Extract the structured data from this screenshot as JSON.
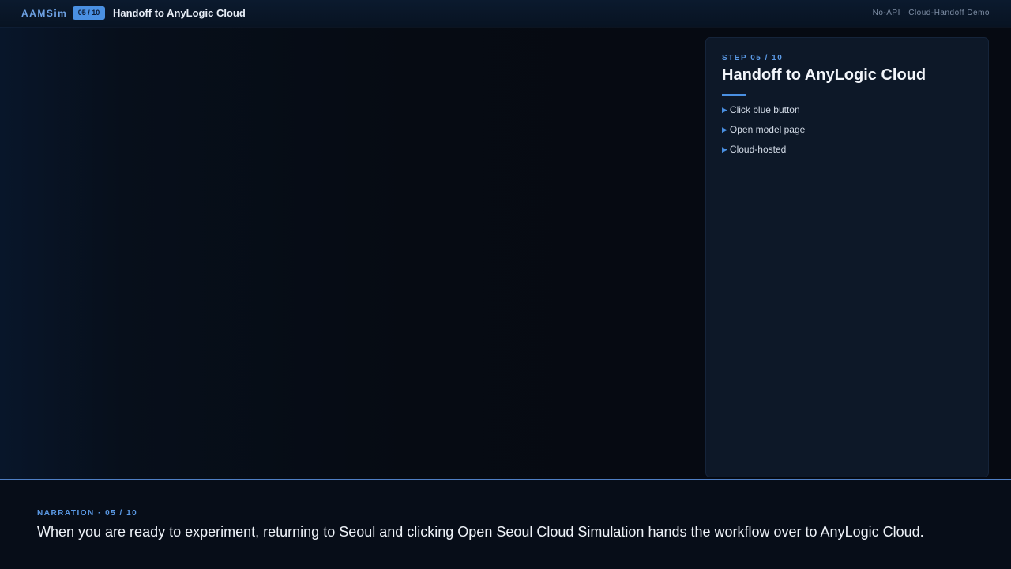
{
  "header": {
    "brand": "AAMSim",
    "step_badge": "05 / 10",
    "title": "Handoff to AnyLogic Cloud",
    "right_label": "No-API · Cloud-Handoff Demo"
  },
  "panel": {
    "step_label": "STEP 05 / 10",
    "title": "Handoff to AnyLogic Cloud",
    "bullets": [
      "Click blue button",
      "Open model page",
      "Cloud-hosted"
    ]
  },
  "narration": {
    "label": "NARRATION · 05 / 10",
    "text": "When you are ready to experiment, returning to Seoul and clicking Open Seoul Cloud Simulation hands the workflow over to AnyLogic Cloud."
  },
  "colors": {
    "accent": "#4a90e2",
    "background": "#060a12",
    "panel": "#0d1828"
  },
  "icons": {
    "bullet": "triangle-right-icon"
  }
}
